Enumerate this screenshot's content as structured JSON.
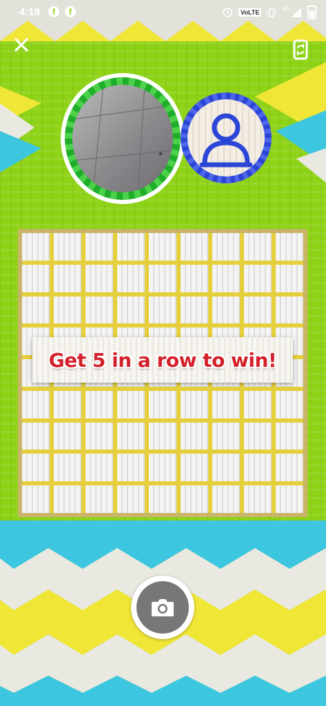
{
  "status_bar": {
    "time": "4:19",
    "volte_label": "VoLTE",
    "network_label": "4G"
  },
  "game": {
    "instruction": "Get 5 in a row to win!",
    "board_rows": 9,
    "board_cols": 9
  },
  "icons": {
    "close": "close-icon",
    "flip_camera": "flip-camera-icon",
    "shutter": "camera-icon",
    "opponent": "person-icon"
  },
  "colors": {
    "background_green": "#8fd318",
    "player_ring": "#1fae2a",
    "opponent_ring": "#2b46d6",
    "banner_text": "#d4202a",
    "grid_lines": "#e6cf3c"
  }
}
